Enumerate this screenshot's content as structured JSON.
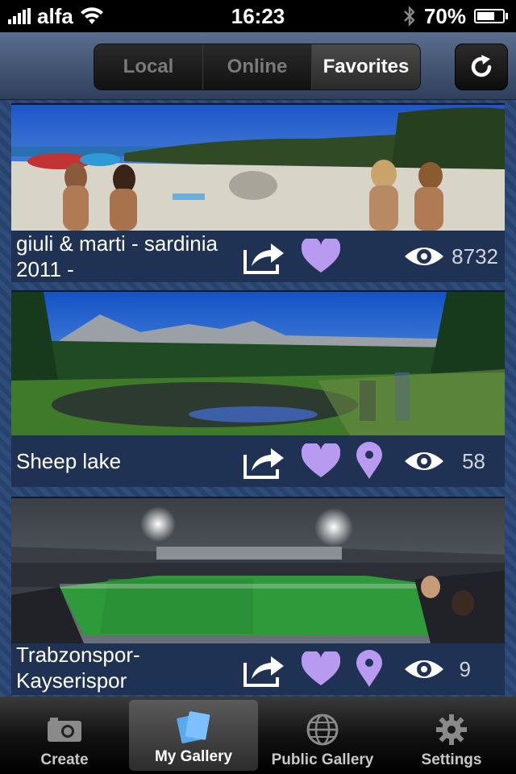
{
  "status": {
    "carrier": "alfa",
    "time": "16:23",
    "battery": "70%"
  },
  "nav": {
    "segments": [
      "Local",
      "Online",
      "Favorites"
    ],
    "active_segment": 2
  },
  "items": [
    {
      "title_line1": "giuli & marti - sardinia",
      "title_line2": "2011 -",
      "views": "8732",
      "has_location": false
    },
    {
      "title_line1": "Sheep lake",
      "title_line2": "",
      "views": "58",
      "has_location": true
    },
    {
      "title_line1": "Trabzonspor-",
      "title_line2": "Kayserispor",
      "views": "9",
      "has_location": true
    }
  ],
  "tabs": [
    {
      "label": "Create",
      "icon": "camera-icon"
    },
    {
      "label": "My Gallery",
      "icon": "gallery-icon"
    },
    {
      "label": "Public Gallery",
      "icon": "globe-icon"
    },
    {
      "label": "Settings",
      "icon": "gear-icon"
    }
  ],
  "active_tab": 1,
  "colors": {
    "heart": "#b89af0",
    "pin": "#b89af0",
    "background": "#2f4d7a"
  }
}
